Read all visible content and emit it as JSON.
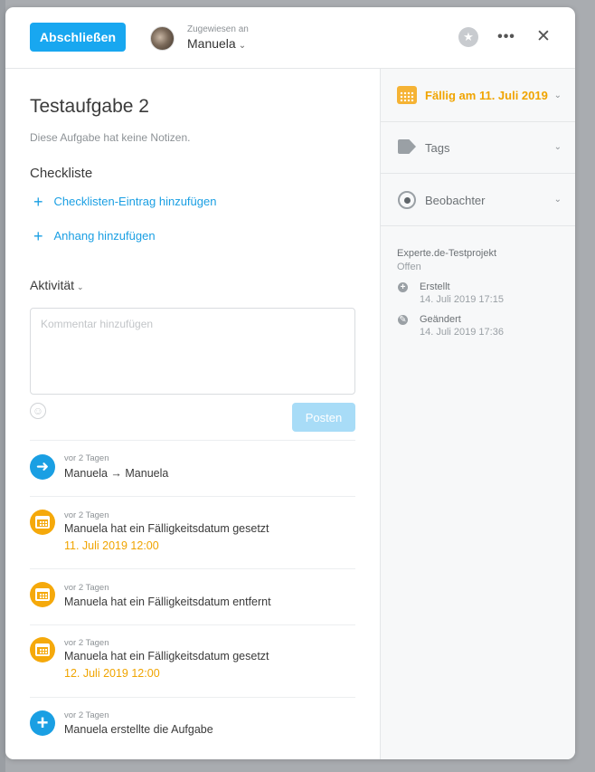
{
  "header": {
    "complete_label": "Abschließen",
    "assigned_caption": "Zugewiesen an",
    "assignee_name": "Manuela"
  },
  "task": {
    "title": "Testaufgabe 2",
    "notes": "Diese Aufgabe hat keine Notizen."
  },
  "checklist": {
    "heading": "Checkliste",
    "add_item_label": "Checklisten-Eintrag hinzufügen",
    "add_attachment_label": "Anhang hinzufügen"
  },
  "activity": {
    "heading": "Aktivität",
    "comment_placeholder": "Kommentar hinzufügen",
    "post_label": "Posten",
    "items": [
      {
        "time": "vor 2 Tagen",
        "text": "Manuela → Manuela",
        "icon": "arrow-right-icon",
        "color": "#1a9fe3"
      },
      {
        "time": "vor 2 Tagen",
        "text": "Manuela hat ein Fälligkeitsdatum gesetzt",
        "date": "11. Juli 2019 12:00",
        "icon": "calendar-icon",
        "color": "#f5a90b"
      },
      {
        "time": "vor 2 Tagen",
        "text": "Manuela hat ein Fälligkeitsdatum entfernt",
        "icon": "calendar-icon",
        "color": "#f5a90b"
      },
      {
        "time": "vor 2 Tagen",
        "text": "Manuela hat ein Fälligkeitsdatum gesetzt",
        "date": "12. Juli 2019 12:00",
        "icon": "calendar-icon",
        "color": "#f5a90b"
      },
      {
        "time": "vor 2 Tagen",
        "text": "Manuela erstellte die Aufgabe",
        "icon": "plus-icon",
        "color": "#1a9fe3"
      }
    ]
  },
  "sidebar": {
    "due_label": "Fällig am 11. Juli 2019",
    "tags_label": "Tags",
    "watchers_label": "Beobachter",
    "project_name": "Experte.de-Testprojekt",
    "project_status": "Offen",
    "created_label": "Erstellt",
    "created_value": "14. Juli 2019 17:15",
    "modified_label": "Geändert",
    "modified_value": "14. Juli 2019 17:36"
  },
  "colors": {
    "accent": "#1a9fe3",
    "due": "#f0a400",
    "post_disabled": "#a8dcf7"
  }
}
